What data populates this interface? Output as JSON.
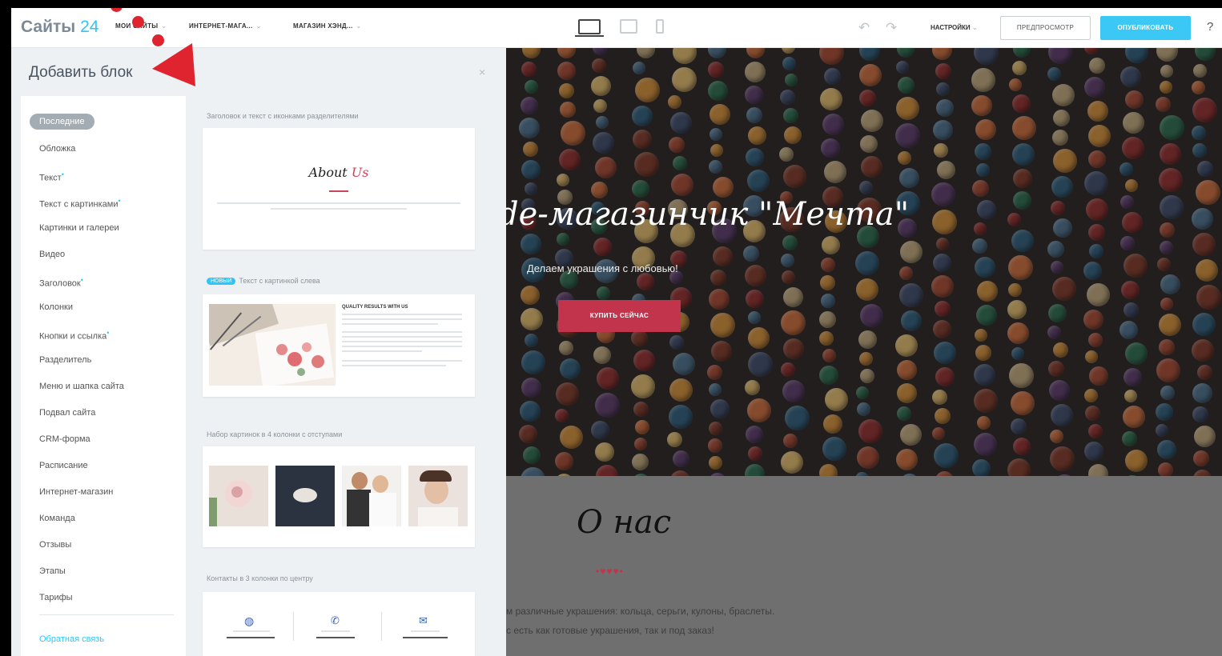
{
  "app": {
    "logo_text": "Сайты",
    "logo_num": "24",
    "accent": "#2fc6f6"
  },
  "breadcrumbs": [
    {
      "label": "МОИ САЙТЫ"
    },
    {
      "label": "ИНТЕРНЕТ-МАГА..."
    },
    {
      "label": "МАГАЗИН ХЭНД..."
    }
  ],
  "toolbar": {
    "settings_label": "НАСТРОЙКИ",
    "preview_label": "ПРЕДПРОСМОТР",
    "publish_label": "ОПУБЛИКОВАТЬ",
    "help_label": "?",
    "undo_icon": "undo-icon",
    "redo_icon": "redo-icon"
  },
  "panel": {
    "title": "Добавить блок",
    "close": "×",
    "categories": [
      {
        "label": "Последние",
        "active": true
      },
      {
        "label": "Обложка"
      },
      {
        "label": "Текст",
        "marked": true
      },
      {
        "label": "Текст с картинками",
        "marked": true
      },
      {
        "label": "Картинки и галереи"
      },
      {
        "label": "Видео"
      },
      {
        "label": "Заголовок",
        "marked": true
      },
      {
        "label": "Колонки"
      },
      {
        "label": "Кнопки и ссылка",
        "marked": true
      },
      {
        "label": "Разделитель"
      },
      {
        "label": "Меню и шапка сайта"
      },
      {
        "label": "Подвал сайта"
      },
      {
        "label": "CRM-форма"
      },
      {
        "label": "Расписание"
      },
      {
        "label": "Интернет-магазин"
      },
      {
        "label": "Команда"
      },
      {
        "label": "Отзывы"
      },
      {
        "label": "Этапы"
      },
      {
        "label": "Тарифы"
      }
    ],
    "feedback": "Обратная связь",
    "blocks": [
      {
        "label": "Заголовок и текст с иконками разделителями",
        "about_a": "About ",
        "about_b": "Us"
      },
      {
        "badge": "НОВЫЙ",
        "label": "Текст с картинкой слева",
        "heading": "QUALITY RESULTS WITH US"
      },
      {
        "label": "Набор картинок в 4 колонки с отступами"
      },
      {
        "label": "Контакты в 3 колонки по центру"
      }
    ]
  },
  "preview": {
    "hero_title": "de-магазинчик \"Мечта\"",
    "hero_sub": "Делаем украшения с любовью!",
    "hero_button": "КУПИТЬ СЕЙЧАС",
    "about_title": "О нас",
    "hearts": "•♥♥♥•",
    "about_p1": "м различные украшения: кольца, серьги, кулоны, браслеты.",
    "about_p2": "с есть как готовые украшения, так и под заказ!",
    "accent": "#c1344c"
  }
}
